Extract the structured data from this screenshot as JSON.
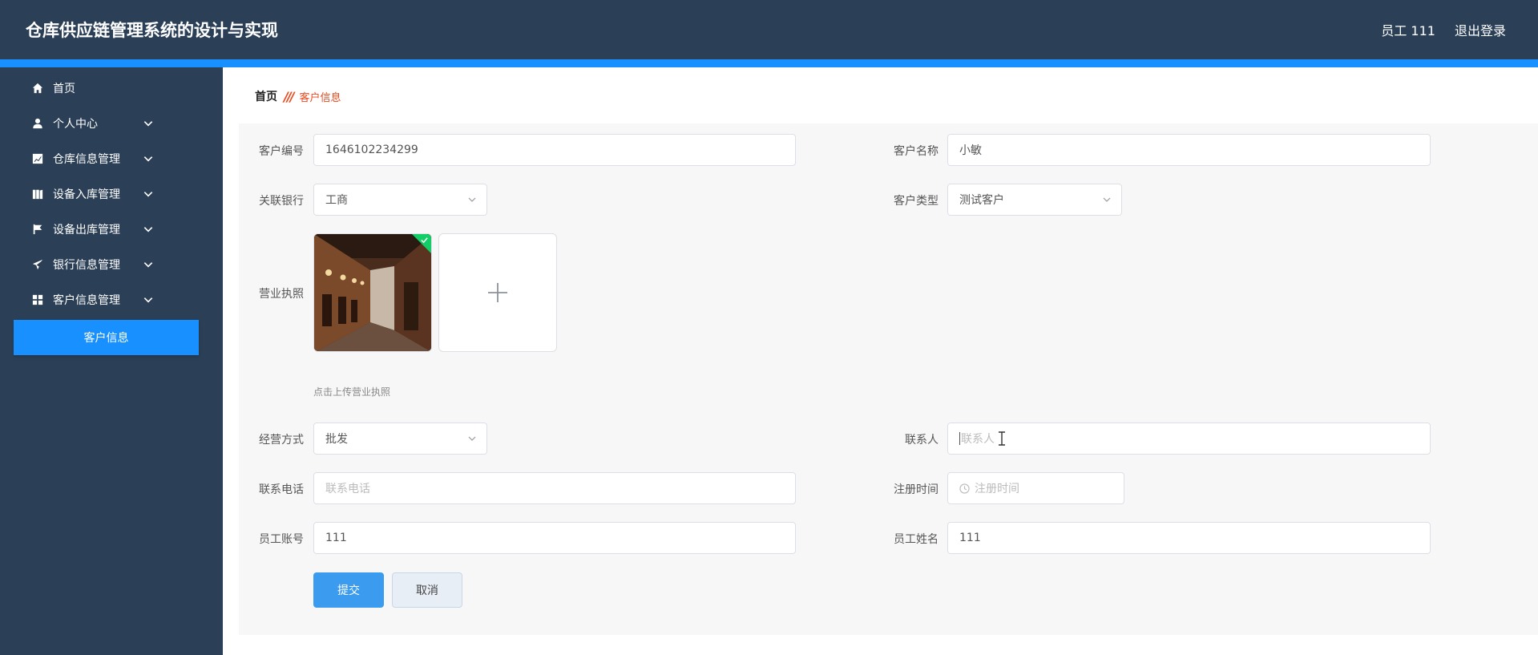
{
  "header": {
    "title": "仓库供应链管理系统的设计与实现",
    "user_label": "员工 111",
    "logout_label": "退出登录"
  },
  "sidebar": {
    "items": [
      {
        "label": "首页",
        "icon": "home-icon"
      },
      {
        "label": "个人中心",
        "icon": "user-icon"
      },
      {
        "label": "仓库信息管理",
        "icon": "chart-icon"
      },
      {
        "label": "设备入库管理",
        "icon": "book-icon"
      },
      {
        "label": "设备出库管理",
        "icon": "flag-icon"
      },
      {
        "label": "银行信息管理",
        "icon": "send-icon"
      },
      {
        "label": "客户信息管理",
        "icon": "grid-icon"
      }
    ],
    "active_sub": "客户信息"
  },
  "breadcrumb": {
    "home": "首页",
    "separator": "///",
    "current": "客户信息"
  },
  "form": {
    "customer_id": {
      "label": "客户编号",
      "value": "1646102234299"
    },
    "customer_name": {
      "label": "客户名称",
      "value": "小敏"
    },
    "bank": {
      "label": "关联银行",
      "value": "工商"
    },
    "customer_type": {
      "label": "客户类型",
      "value": "测试客户"
    },
    "license": {
      "label": "营业执照",
      "tip": "点击上传营业执照"
    },
    "business_mode": {
      "label": "经营方式",
      "value": "批发"
    },
    "contact": {
      "label": "联系人",
      "placeholder": "联系人"
    },
    "phone": {
      "label": "联系电话",
      "placeholder": "联系电话"
    },
    "reg_time": {
      "label": "注册时间",
      "placeholder": "注册时间"
    },
    "staff_account": {
      "label": "员工账号",
      "value": "111"
    },
    "staff_name": {
      "label": "员工姓名",
      "value": "111"
    },
    "submit_label": "提交",
    "cancel_label": "取消"
  },
  "colors": {
    "header_bg": "#2b3f57",
    "accent": "#1890ff",
    "breadcrumb_active": "#e8491d",
    "success": "#13ce66"
  }
}
